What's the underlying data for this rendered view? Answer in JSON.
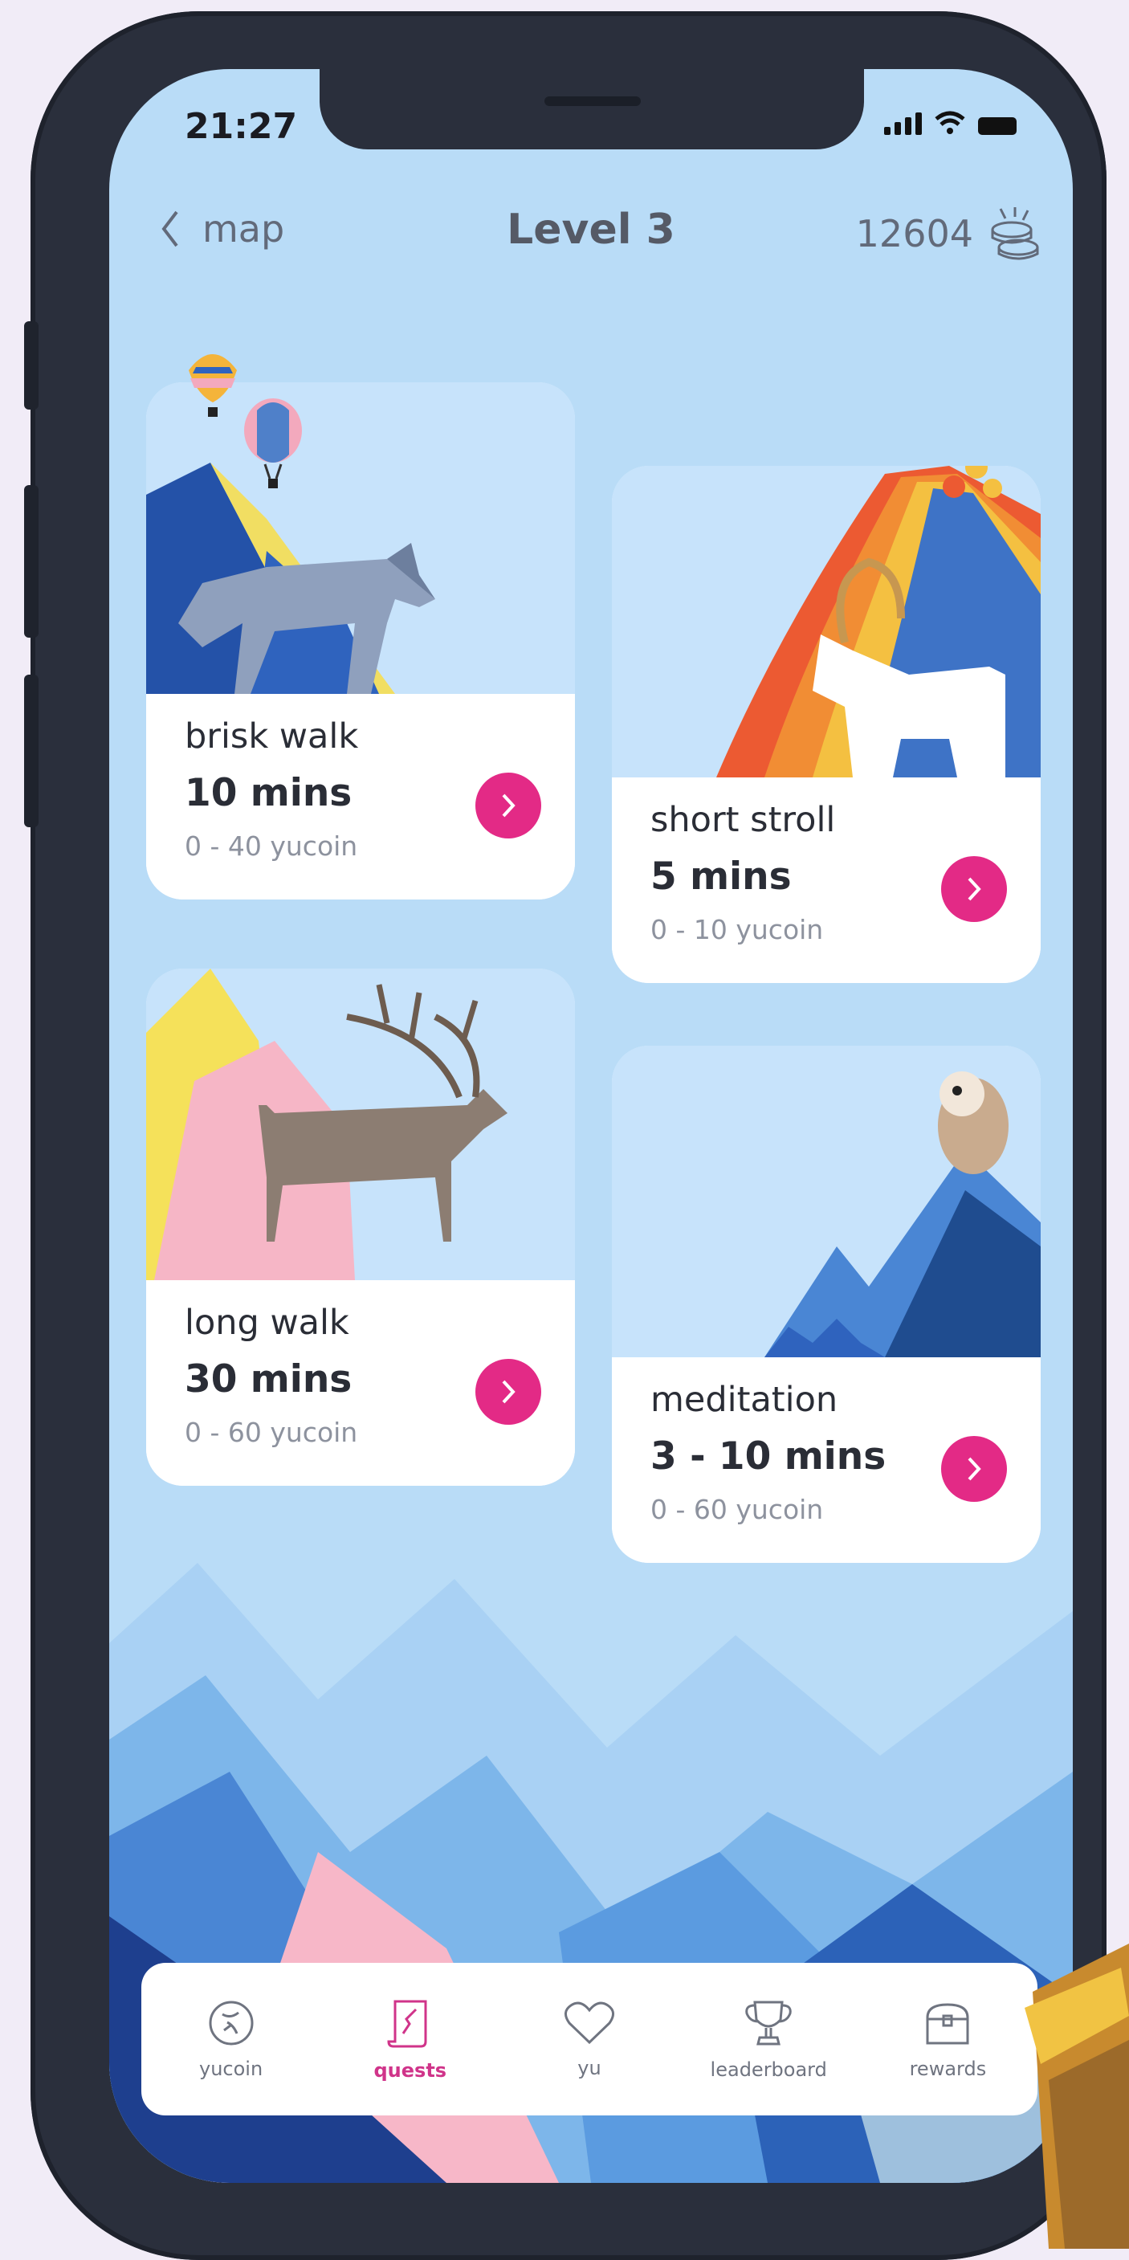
{
  "status_bar": {
    "time": "21:27"
  },
  "header": {
    "back_label": "map",
    "title": "Level 3",
    "coin_balance": "12604"
  },
  "quests": [
    {
      "name": "brisk walk",
      "duration": "10 mins",
      "reward": "0 - 40 yucoin"
    },
    {
      "name": "short stroll",
      "duration": "5 mins",
      "reward": "0 - 10 yucoin"
    },
    {
      "name": "long walk",
      "duration": "30 mins",
      "reward": "0 - 60 yucoin"
    },
    {
      "name": "meditation",
      "duration": "3 - 10 mins",
      "reward": "0 - 60 yucoin"
    }
  ],
  "tabs": [
    {
      "label": "yucoin",
      "icon": "yucoin-icon"
    },
    {
      "label": "quests",
      "icon": "scroll-icon",
      "active": true
    },
    {
      "label": "yu",
      "icon": "heart-icon"
    },
    {
      "label": "leaderboard",
      "icon": "trophy-icon"
    },
    {
      "label": "rewards",
      "icon": "treasure-chest-icon"
    }
  ],
  "colors": {
    "accent": "#e32a86",
    "screen_bg": "#b9dcf7",
    "active_tab": "#d0348a"
  }
}
